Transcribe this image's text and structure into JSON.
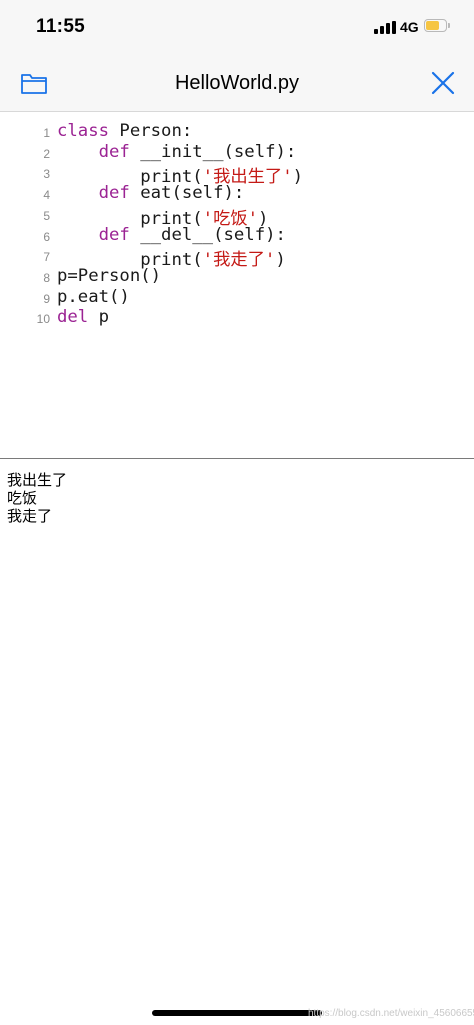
{
  "status_bar": {
    "time": "11:55",
    "network": "4G",
    "signal_bars": 4,
    "battery_level": 0.7,
    "battery_color": "#f6c543"
  },
  "nav": {
    "title": "HelloWorld.py",
    "folder_icon": "folder-icon",
    "close_icon": "close-icon",
    "accent_color": "#1a73e8"
  },
  "editor": {
    "lines": [
      {
        "num": "1",
        "segments": [
          {
            "t": "class",
            "c": "kw"
          },
          {
            "t": " Person:",
            "c": ""
          }
        ]
      },
      {
        "num": "2",
        "segments": [
          {
            "t": "    ",
            "c": ""
          },
          {
            "t": "def",
            "c": "kw"
          },
          {
            "t": " __init__(self):",
            "c": ""
          }
        ]
      },
      {
        "num": "3",
        "segments": [
          {
            "t": "        print(",
            "c": ""
          },
          {
            "t": "'我出生了'",
            "c": "str"
          },
          {
            "t": ")",
            "c": ""
          }
        ]
      },
      {
        "num": "4",
        "segments": [
          {
            "t": "    ",
            "c": ""
          },
          {
            "t": "def",
            "c": "kw"
          },
          {
            "t": " eat(self):",
            "c": ""
          }
        ]
      },
      {
        "num": "5",
        "segments": [
          {
            "t": "        print(",
            "c": ""
          },
          {
            "t": "'吃饭'",
            "c": "str"
          },
          {
            "t": ")",
            "c": ""
          }
        ]
      },
      {
        "num": "6",
        "segments": [
          {
            "t": "    ",
            "c": ""
          },
          {
            "t": "def",
            "c": "kw"
          },
          {
            "t": " __del__(self):",
            "c": ""
          }
        ]
      },
      {
        "num": "7",
        "segments": [
          {
            "t": "        print(",
            "c": ""
          },
          {
            "t": "'我走了'",
            "c": "str"
          },
          {
            "t": ")",
            "c": ""
          }
        ]
      },
      {
        "num": "8",
        "segments": [
          {
            "t": "p=Person()",
            "c": ""
          }
        ]
      },
      {
        "num": "9",
        "segments": [
          {
            "t": "p.eat()",
            "c": ""
          }
        ]
      },
      {
        "num": "10",
        "segments": [
          {
            "t": "del",
            "c": "kw"
          },
          {
            "t": " p",
            "c": ""
          }
        ]
      }
    ]
  },
  "console": {
    "lines": [
      "我出生了",
      "吃饭",
      "我走了"
    ]
  },
  "watermark": "https://blog.csdn.net/weixin_45606655"
}
